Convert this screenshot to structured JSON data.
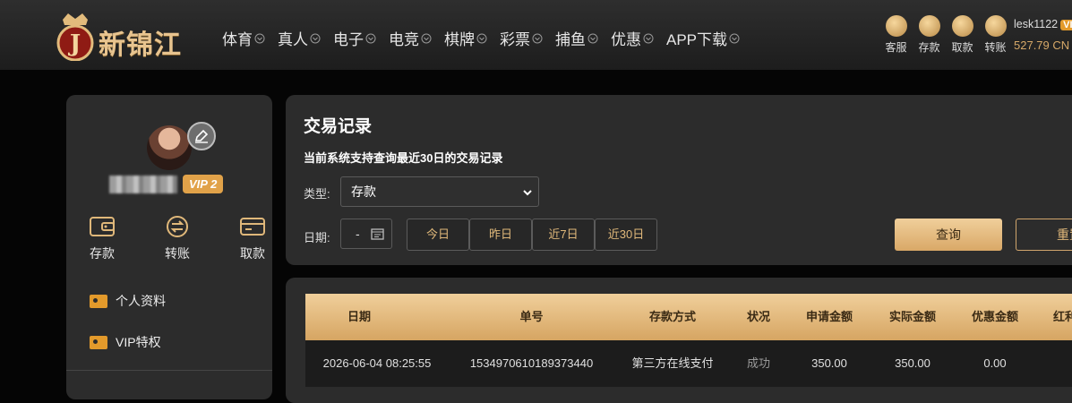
{
  "brand": {
    "name": "新锦江",
    "badge_letter": "J"
  },
  "nav": [
    {
      "label": "体育"
    },
    {
      "label": "真人"
    },
    {
      "label": "电子"
    },
    {
      "label": "电竞"
    },
    {
      "label": "棋牌"
    },
    {
      "label": "彩票"
    },
    {
      "label": "捕鱼"
    },
    {
      "label": "优惠"
    },
    {
      "label": "APP下载"
    }
  ],
  "header_actions": [
    {
      "label": "客服",
      "icon": "customer-service-icon"
    },
    {
      "label": "存款",
      "icon": "deposit-icon"
    },
    {
      "label": "取款",
      "icon": "withdraw-icon"
    },
    {
      "label": "转账",
      "icon": "transfer-icon"
    }
  ],
  "user": {
    "name": "lesk1122",
    "vip": "VI",
    "balance": "527.79 CN"
  },
  "sidebar": {
    "vip_label": "VIP 2",
    "quick_actions": [
      {
        "label": "存款",
        "icon": "wallet-icon"
      },
      {
        "label": "转账",
        "icon": "transfer-icon"
      },
      {
        "label": "取款",
        "icon": "card-icon"
      }
    ],
    "menu": [
      {
        "label": "个人资料",
        "icon": "profile-card-icon"
      },
      {
        "label": "VIP特权",
        "icon": "vip-card-icon"
      }
    ]
  },
  "transactions": {
    "title": "交易记录",
    "subtitle": "当前系统支持查询最近30日的交易记录",
    "type_label": "类型:",
    "type_value": "存款",
    "date_label": "日期:",
    "date_value": "-",
    "quick_ranges": [
      "今日",
      "昨日",
      "近7日",
      "近30日"
    ],
    "search_label": "查询",
    "reset_label": "重置"
  },
  "table": {
    "columns": [
      "日期",
      "单号",
      "存款方式",
      "状况",
      "申请金额",
      "实际金额",
      "优惠金额",
      "红利"
    ],
    "rows": [
      [
        "2026-06-04 08:25:55",
        "1534970610189373440",
        "第三方在线支付",
        "成功",
        "350.00",
        "350.00",
        "0.00",
        ""
      ]
    ]
  },
  "colors": {
    "accent": "#d9a867",
    "vip_orange": "#e39a2b",
    "panel": "#2c2c2c"
  }
}
